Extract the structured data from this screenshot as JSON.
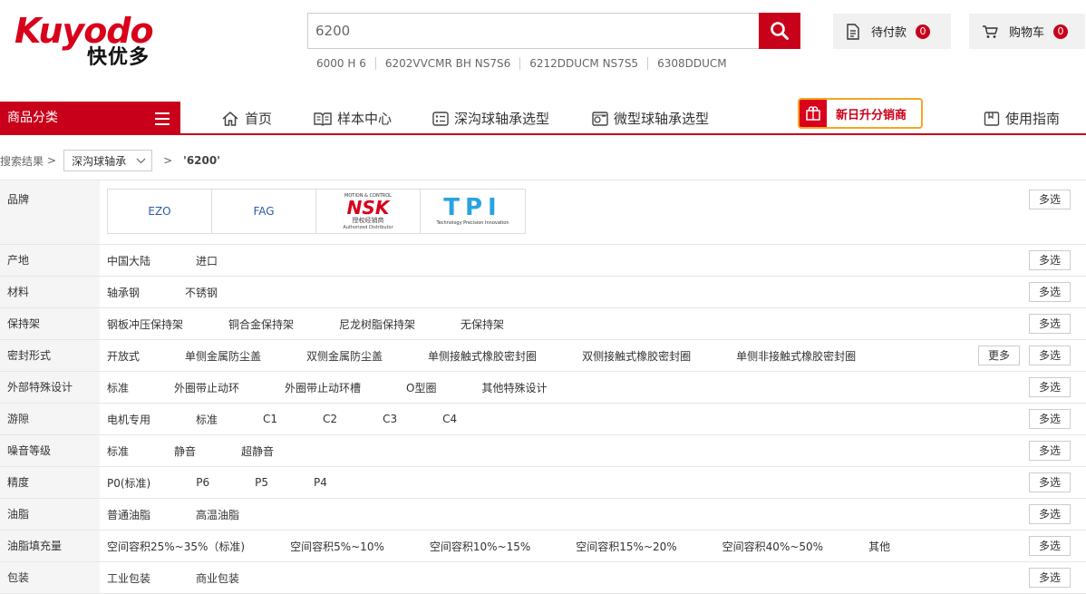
{
  "header": {
    "logo_en": "Kuyodo",
    "logo_cn": "快优多",
    "search_value": "6200",
    "hot_keywords": [
      "6000 H 6",
      "6202VVCMR BH NS7S6",
      "6212DDUCM NS7S5",
      "6308DDUCM"
    ],
    "pending_payment_label": "待付款",
    "pending_payment_count": "0",
    "cart_label": "购物车",
    "cart_count": "0"
  },
  "nav": {
    "category_label": "商品分类",
    "items": [
      "首页",
      "样本中心",
      "深沟球轴承选型",
      "微型球轴承选型"
    ],
    "promo_label": "新日升分销商",
    "guide_label": "使用指南"
  },
  "breadcrumb": {
    "root": "搜索结果",
    "sep": ">",
    "category": "深沟球轴承",
    "keyword": "'6200'"
  },
  "filters": {
    "brand_label": "品牌",
    "brands": [
      {
        "name": "EZO"
      },
      {
        "name": "FAG"
      },
      {
        "name": "NSK",
        "tagline_top": "MOTION & CONTROL",
        "tagline_cn": "授权经销商",
        "tagline_en": "Authorized Distributor"
      },
      {
        "name": "TPI",
        "tagline": "Technology  Precision  Innovation"
      }
    ],
    "multi_label": "多选",
    "more_label": "更多",
    "rows": [
      {
        "label": "产地",
        "options": [
          "中国大陆",
          "进口"
        ]
      },
      {
        "label": "材料",
        "options": [
          "轴承钢",
          "不锈钢"
        ]
      },
      {
        "label": "保持架",
        "options": [
          "钢板冲压保持架",
          "铜合金保持架",
          "尼龙树脂保持架",
          "无保持架"
        ]
      },
      {
        "label": "密封形式",
        "options": [
          "开放式",
          "单侧金属防尘盖",
          "双侧金属防尘盖",
          "单侧接触式橡胶密封圈",
          "双侧接触式橡胶密封圈",
          "单侧非接触式橡胶密封圈"
        ],
        "more": true
      },
      {
        "label": "外部特殊设计",
        "options": [
          "标准",
          "外圈带止动环",
          "外圈带止动环槽",
          "O型圈",
          "其他特殊设计"
        ]
      },
      {
        "label": "游隙",
        "options": [
          "电机专用",
          "标准",
          "C1",
          "C2",
          "C3",
          "C4"
        ]
      },
      {
        "label": "噪音等级",
        "options": [
          "标准",
          "静音",
          "超静音"
        ]
      },
      {
        "label": "精度",
        "options": [
          "P0(标准)",
          "P6",
          "P5",
          "P4"
        ]
      },
      {
        "label": "油脂",
        "options": [
          "普通油脂",
          "高温油脂"
        ]
      },
      {
        "label": "油脂填充量",
        "options": [
          "空间容积25%~35%（标准)",
          "空间容积5%~10%",
          "空间容积10%~15%",
          "空间容积15%~20%",
          "空间容积40%~50%",
          "其他"
        ]
      },
      {
        "label": "包装",
        "options": [
          "工业包装",
          "商业包装"
        ]
      }
    ]
  }
}
